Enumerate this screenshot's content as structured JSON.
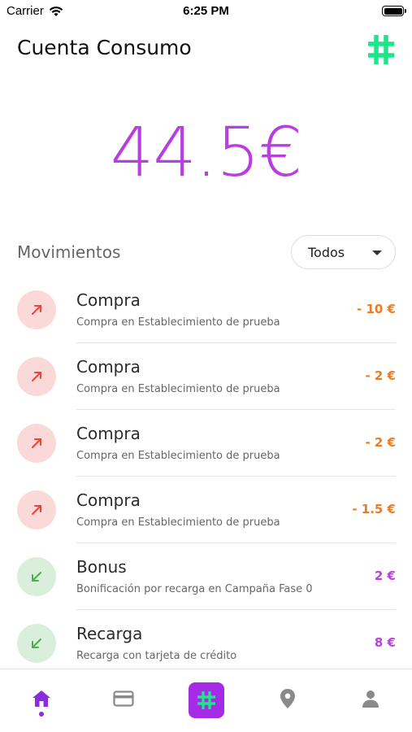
{
  "status_bar": {
    "carrier": "Carrier",
    "time": "6:25 PM"
  },
  "header": {
    "title": "Cuenta Consumo",
    "logo_icon": "hashtag-logo-icon",
    "logo_color": "#1ee58a"
  },
  "balance": {
    "amount": "44.5€",
    "color": "#b83ee0"
  },
  "movements": {
    "title": "Movimientos",
    "filter": {
      "selected": "Todos"
    },
    "items": [
      {
        "type": "out",
        "icon": "arrow-up-right-icon",
        "title": "Compra",
        "subtitle": "Compra en Establecimiento de prueba",
        "amount": "- 10 €"
      },
      {
        "type": "out",
        "icon": "arrow-up-right-icon",
        "title": "Compra",
        "subtitle": "Compra en Establecimiento de prueba",
        "amount": "- 2 €"
      },
      {
        "type": "out",
        "icon": "arrow-up-right-icon",
        "title": "Compra",
        "subtitle": "Compra en Establecimiento de prueba",
        "amount": "- 2 €"
      },
      {
        "type": "out",
        "icon": "arrow-up-right-icon",
        "title": "Compra",
        "subtitle": "Compra en Establecimiento de prueba",
        "amount": "- 1.5 €"
      },
      {
        "type": "in",
        "icon": "arrow-down-left-icon",
        "title": "Bonus",
        "subtitle": "Bonificación por recarga en Campaña Fase 0",
        "amount": "2 €"
      },
      {
        "type": "in",
        "icon": "arrow-down-left-icon",
        "title": "Recarga",
        "subtitle": "Recarga con tarjeta de crédito",
        "amount": "8 €"
      }
    ]
  },
  "tabbar": {
    "tabs": [
      {
        "icon": "home-icon",
        "active": true
      },
      {
        "icon": "card-icon",
        "active": false
      },
      {
        "icon": "hashtag-icon",
        "active": false
      },
      {
        "icon": "location-pin-icon",
        "active": false
      },
      {
        "icon": "user-icon",
        "active": false
      }
    ],
    "active_color": "#8b2be2",
    "center_color": "#a62be6"
  },
  "colors": {
    "negative": "#f07a1e",
    "positive": "#b83ee0",
    "out_bg": "#fbd9d9",
    "in_bg": "#d9eedb",
    "out_arrow": "#e8453c",
    "in_arrow": "#4caf50"
  }
}
